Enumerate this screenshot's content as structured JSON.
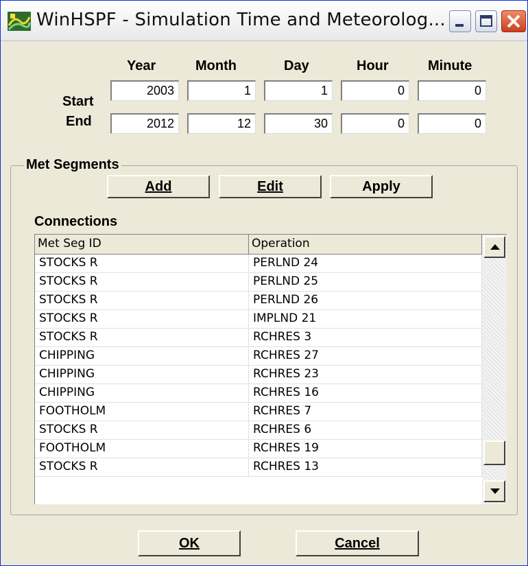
{
  "window": {
    "title": "WinHSPF - Simulation Time and Meteorolog...",
    "icon": "winhspf-app-icon"
  },
  "time": {
    "column_headers": [
      "Year",
      "Month",
      "Day",
      "Hour",
      "Minute"
    ],
    "start_label": "Start",
    "end_label": "End",
    "start": [
      "2003",
      "1",
      "1",
      "0",
      "0"
    ],
    "end": [
      "2012",
      "12",
      "30",
      "0",
      "0"
    ]
  },
  "met_segments": {
    "group_title": "Met Segments",
    "add_button": "Add",
    "edit_button": "Edit",
    "apply_button": "Apply",
    "connections_label": "Connections"
  },
  "table": {
    "headers": [
      "Met Seg ID",
      "Operation"
    ],
    "rows": [
      [
        "STOCKS R",
        "PERLND 24"
      ],
      [
        "STOCKS R",
        "PERLND 25"
      ],
      [
        "STOCKS R",
        "PERLND 26"
      ],
      [
        "STOCKS R",
        "IMPLND 21"
      ],
      [
        "STOCKS R",
        "RCHRES 3"
      ],
      [
        "CHIPPING",
        "RCHRES 27"
      ],
      [
        "CHIPPING",
        "RCHRES 23"
      ],
      [
        "CHIPPING",
        "RCHRES 16"
      ],
      [
        "FOOTHOLM",
        "RCHRES 7"
      ],
      [
        "STOCKS R",
        "RCHRES 6"
      ],
      [
        "FOOTHOLM",
        "RCHRES 19"
      ],
      [
        "STOCKS R",
        "RCHRES 13"
      ]
    ]
  },
  "buttons": {
    "ok": "OK",
    "cancel": "Cancel"
  }
}
